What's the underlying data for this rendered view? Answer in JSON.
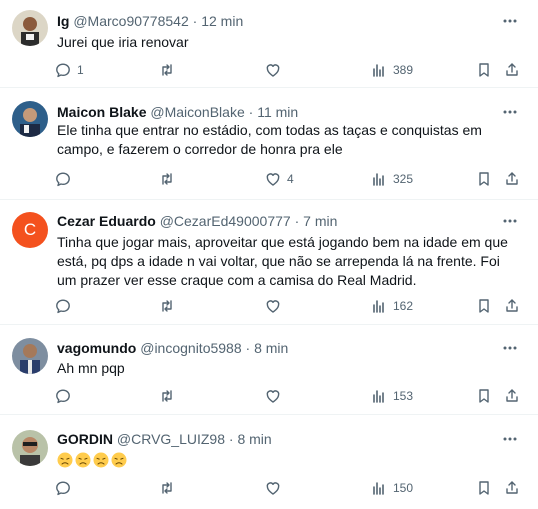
{
  "posts": [
    {
      "id": "post-ig",
      "name": "Ig",
      "handle": "@Marco90778542",
      "sep": "·",
      "time": "12 min",
      "text": "Jurei que iria renovar",
      "replies": "1",
      "likes": "",
      "views": "389"
    },
    {
      "id": "post-maicon",
      "name": "Maicon Blake",
      "handle": "@MaiconBlake",
      "sep": "·",
      "time": "11 min",
      "text": "Ele tinha que entrar no estádio, com todas as taças e conquistas em campo, e fazerem o corredor de honra pra ele",
      "replies": "",
      "likes": "4",
      "views": "325"
    },
    {
      "id": "post-cezar",
      "name": "Cezar Eduardo",
      "handle": "@CezarEd49000777",
      "sep": "·",
      "time": "7 min",
      "avatar_letter": "C",
      "text": "Tinha que jogar mais, aproveitar que está jogando bem na idade em que está, pq dps a idade n vai voltar, que não se arrependa lá na frente. Foi um prazer ver esse craque com a camisa do Real Madrid.",
      "replies": "",
      "likes": "",
      "views": "162"
    },
    {
      "id": "post-vagomundo",
      "name": "vagomundo",
      "handle": "@incognito5988",
      "sep": "·",
      "time": "8 min",
      "text": "Ah mn pqp",
      "replies": "",
      "likes": "",
      "views": "153"
    },
    {
      "id": "post-gordin",
      "name": "GORDIN",
      "handle": "@CRVG_LUIZ98",
      "sep": "·",
      "time": "8 min",
      "text": "",
      "emoji": [
        "disappointed-face",
        "disappointed-face",
        "disappointed-face",
        "disappointed-face"
      ],
      "replies": "",
      "likes": "",
      "views": "150"
    }
  ],
  "colors": {
    "muted": "#536471",
    "text": "#0f1419",
    "divider": "#eff3f4",
    "avatar_c": "#f4511e",
    "emoji_yellow": "#ffcc4d"
  }
}
